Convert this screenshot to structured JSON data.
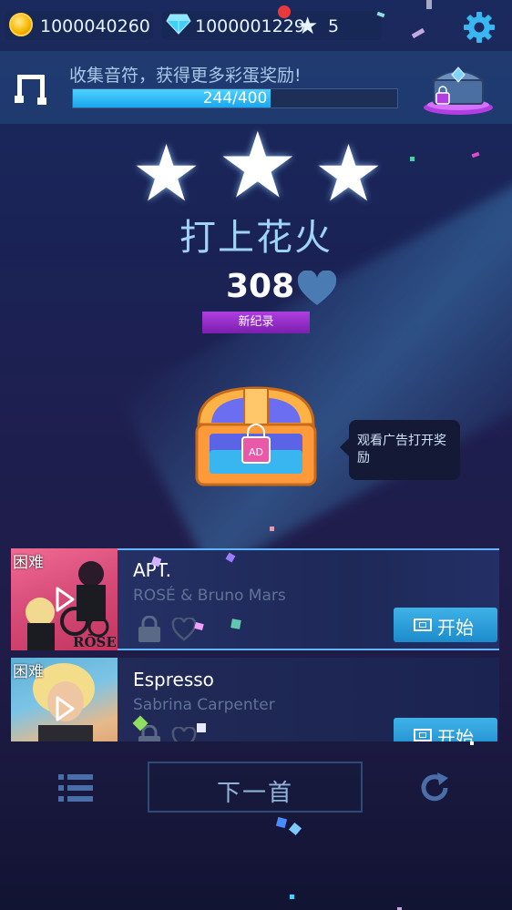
{
  "currency": {
    "coins": "1000040260",
    "diamonds": "1000001229",
    "stars": "5"
  },
  "collect": {
    "text": "收集音符，获得更多彩蛋奖励!",
    "progress_label": "244/400",
    "progress_fraction": 0.61
  },
  "result": {
    "stars_earned": 3,
    "song_title": "打上花火",
    "score": "308",
    "record_badge": "新纪录"
  },
  "reward": {
    "chest_label": "AD",
    "tooltip": "观看广告打开奖励"
  },
  "songs": [
    {
      "difficulty": "困难",
      "title": "APT.",
      "artist": "ROSÉ & Bruno Mars",
      "cover_text": "RŌSE",
      "start_label": "开始"
    },
    {
      "difficulty": "困难",
      "title": "Espresso",
      "artist": "Sabrina Carpenter",
      "start_label": "开始"
    }
  ],
  "bottom": {
    "next_label": "下一首"
  },
  "colors": {
    "accent": "#1d8ccc",
    "record_badge": "#9b2fd0",
    "progress_fill": "#35bff7"
  }
}
